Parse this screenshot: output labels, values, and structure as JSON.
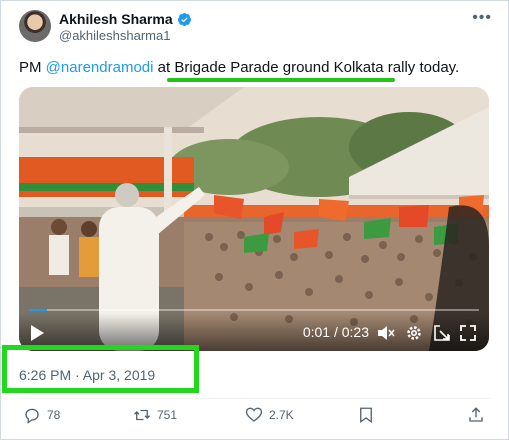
{
  "author": {
    "name": "Akhilesh Sharma",
    "handle": "@akhileshsharma1",
    "verified_color": "#1d9bf0"
  },
  "menu_icon": "more-dots-icon",
  "tweet": {
    "prefix": "PM ",
    "mention": "@narendramodi",
    "middle": " at ",
    "highlight": "Brigade Parade ground Kolkata rally",
    "suffix": " today."
  },
  "video": {
    "time": "0:01 / 0:23",
    "progress_fraction": 0.04,
    "controls": [
      "play-icon",
      "mute-icon",
      "settings-icon",
      "pop-out-icon",
      "fullscreen-icon"
    ]
  },
  "timestamp": "6:26 PM · Apr 3, 2019",
  "highlight_color": "#22d81c",
  "actions": {
    "replies": "78",
    "retweets": "751",
    "likes": "2.7K",
    "bookmark_icon": "bookmark-icon",
    "share_icon": "share-icon"
  }
}
